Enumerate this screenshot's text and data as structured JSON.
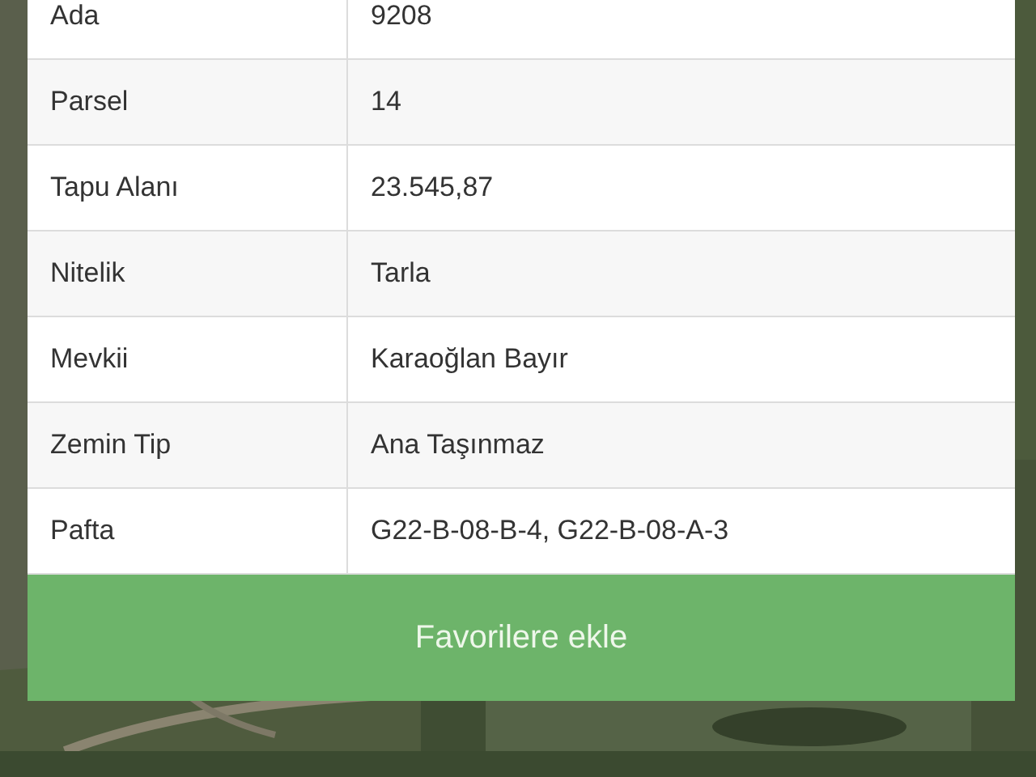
{
  "details": [
    {
      "label": "Ada",
      "value": "9208"
    },
    {
      "label": "Parsel",
      "value": "14"
    },
    {
      "label": "Tapu Alanı",
      "value": "23.545,87"
    },
    {
      "label": "Nitelik",
      "value": "Tarla"
    },
    {
      "label": "Mevkii",
      "value": "Karaoğlan Bayır"
    },
    {
      "label": "Zemin Tip",
      "value": "Ana Taşınmaz"
    },
    {
      "label": "Pafta",
      "value": "G22-B-08-B-4, G22-B-08-A-3"
    }
  ],
  "favorite_button": {
    "label": "Favorilere ekle"
  }
}
